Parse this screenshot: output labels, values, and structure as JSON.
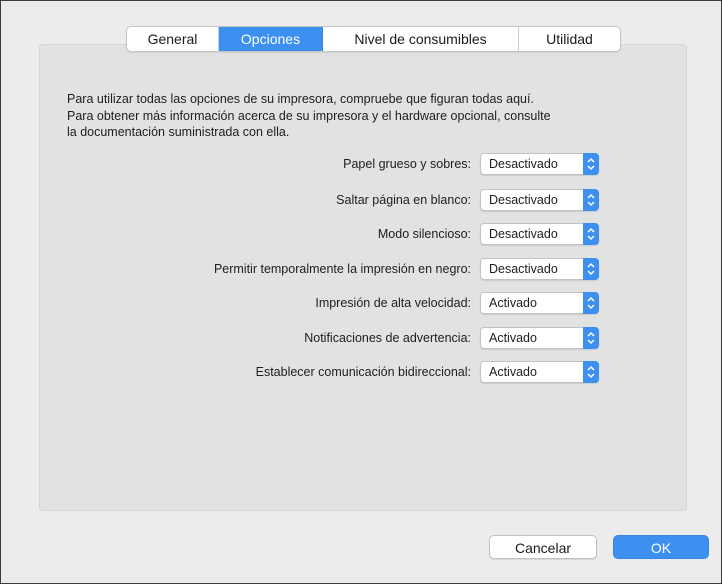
{
  "tabs": [
    {
      "label": "General",
      "active": false
    },
    {
      "label": "Opciones",
      "active": true
    },
    {
      "label": "Nivel de consumibles",
      "active": false
    },
    {
      "label": "Utilidad",
      "active": false
    }
  ],
  "intro": {
    "line1": "Para utilizar todas las opciones de su impresora, compruebe que figuran todas aquí.",
    "line2": "Para obtener más información acerca de su impresora y el hardware opcional, consulte",
    "line3": "la documentación suministrada con ella."
  },
  "options": [
    {
      "label": "Papel grueso y sobres:",
      "value": "Desactivado"
    },
    {
      "label": "Saltar página en blanco:",
      "value": "Desactivado"
    },
    {
      "label": "Modo silencioso:",
      "value": "Desactivado"
    },
    {
      "label": "Permitir temporalmente la impresión en negro:",
      "value": "Desactivado"
    },
    {
      "label": "Impresión de alta velocidad:",
      "value": "Activado"
    },
    {
      "label": "Notificaciones de advertencia:",
      "value": "Activado"
    },
    {
      "label": "Establecer comunicación bidireccional:",
      "value": "Activado"
    }
  ],
  "buttons": {
    "cancel_label": "Cancelar",
    "ok_label": "OK"
  },
  "colors": {
    "accent": "#3d8ff0",
    "window_bg": "#ececec",
    "panel_bg": "#e2e2e2"
  }
}
